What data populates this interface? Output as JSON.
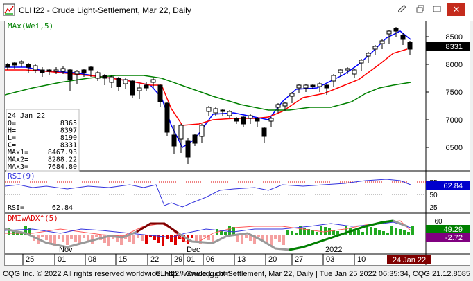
{
  "window": {
    "title": "CLH22 - Crude Light-Settlement, Mar 22, Daily",
    "icons": [
      "chart-app-icon",
      "attach-icon",
      "restore-icon",
      "maximize-icon",
      "close-icon"
    ]
  },
  "study_labels": {
    "mas": "MAx(Wei,5)",
    "rsi": "RSI(9)",
    "rsi_value_label": "RSI=",
    "rsi_value": "62.84",
    "dmi": "DMIwADX^(5)"
  },
  "data_box": {
    "date": "24 Jan 22",
    "rows": [
      {
        "label": "O=",
        "value": "8365"
      },
      {
        "label": "H=",
        "value": "8397"
      },
      {
        "label": "L=",
        "value": "8190"
      },
      {
        "label": "C=",
        "value": "8331"
      },
      {
        "label": "MAx1=",
        "value": "8467.93"
      },
      {
        "label": "MAx2=",
        "value": "8288.22"
      },
      {
        "label": "MAx3=",
        "value": "7684.80"
      }
    ]
  },
  "price_axis": {
    "ticks": [
      "8500",
      "8000",
      "7500",
      "7000",
      "6500"
    ],
    "last_price": "8331"
  },
  "rsi_axis": {
    "ticks": [
      "75",
      "50",
      "25"
    ],
    "current": "62.84"
  },
  "dmi_axis": {
    "ticks": [
      "60",
      "49.29",
      "-2.72"
    ],
    "values": [
      "49.29",
      "-2.72"
    ]
  },
  "time_axis": {
    "months": [
      "Nov",
      "Dec",
      "2022"
    ],
    "days": [
      "25",
      "01",
      "08",
      "15",
      "22",
      "29",
      "01",
      "06",
      "13",
      "20",
      "27",
      "03",
      "10"
    ],
    "current_date": "24 Jan 22"
  },
  "status": {
    "left": "CQG Inc. © 2022 All rights reserved worldwide. http://www.cqg.com",
    "right": "CLH22 - Crude Light-Settlement, Mar 22, Daily | Tue Jan 25 2022 06:35:34, CQG 21.12.8085"
  },
  "colors": {
    "ma_fast": "#0000ff",
    "ma_mid": "#ff0000",
    "ma_slow": "#008000",
    "candle": "#000000",
    "last_price_bg": "#000000",
    "rsi_line": "#3333dd",
    "rsi_badge": "#0000cc",
    "dmi_pos": "#22aa22",
    "dmi_neg": "#dd0000",
    "adx_badge": "#800080",
    "date_badge": "#800000"
  }
}
